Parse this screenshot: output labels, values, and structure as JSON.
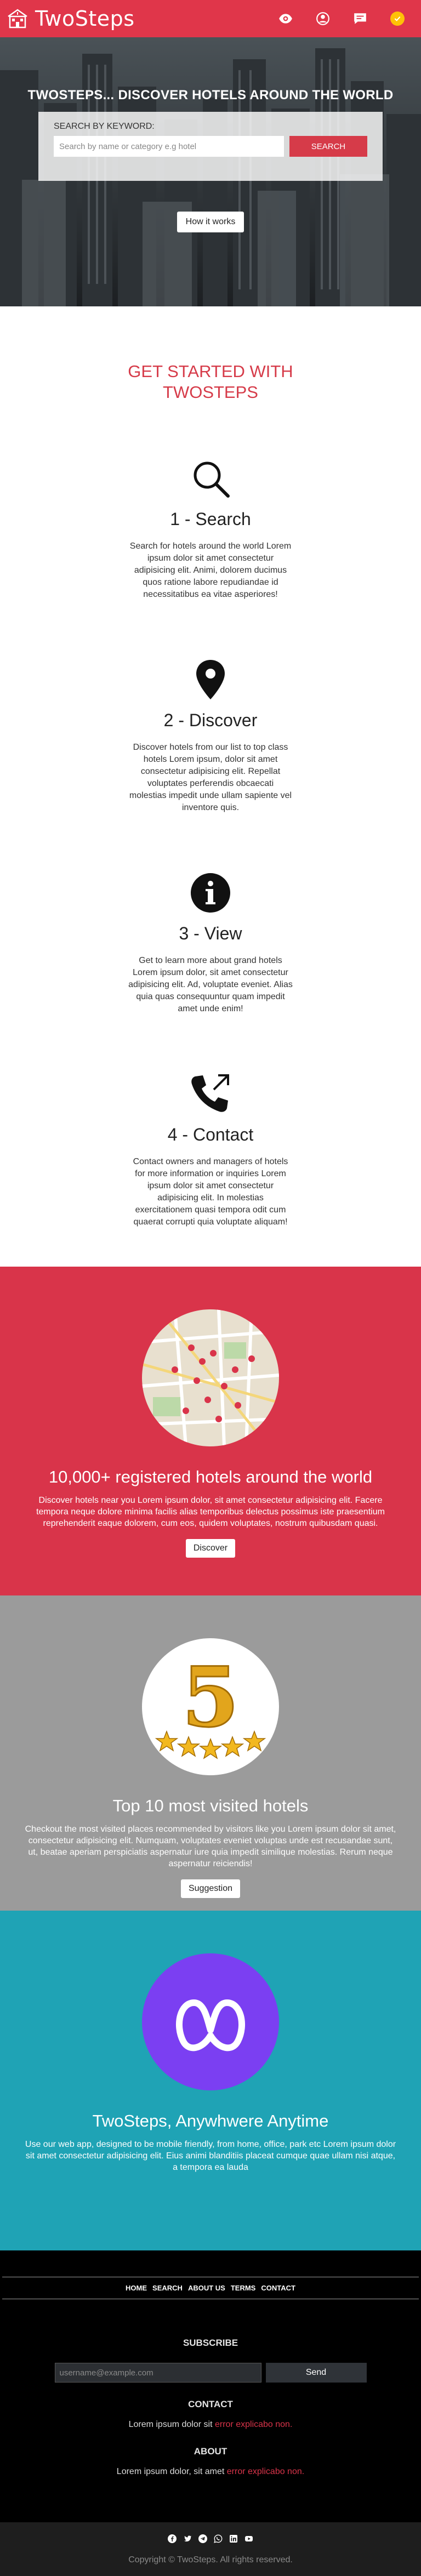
{
  "brand": {
    "name": "TwoSteps"
  },
  "nav": {
    "icons": [
      "eye-icon",
      "user-icon",
      "chat-icon",
      "badge-check-icon"
    ],
    "accent": "#e0364a",
    "badge_color": "#ffc107"
  },
  "hero": {
    "title": "TWOSTEPS... DISCOVER HOTELS AROUND THE WORLD",
    "search_label": "SEARCH BY KEYWORD:",
    "search_placeholder": "Search by name or category e.g hotel",
    "search_button": "SEARCH",
    "how_button": "How it works"
  },
  "steps": {
    "title": "GET STARTED WITH TWOSTEPS",
    "items": [
      {
        "icon": "search-icon",
        "title": "1 - Search",
        "text": "Search for hotels around the world Lorem ipsum dolor sit amet consectetur adipisicing elit. Animi, dolorem ducimus quos ratione labore repudiandae id necessitatibus ea vitae asperiores!"
      },
      {
        "icon": "map-pin-icon",
        "title": "2 - Discover",
        "text": "Discover hotels from our list to top class hotels Lorem ipsum, dolor sit amet consectetur adipisicing elit. Repellat voluptates perferendis obcaecati molestias impedit unde ullam sapiente vel inventore quis."
      },
      {
        "icon": "info-icon",
        "title": "3 - View",
        "text": "Get to learn more about grand hotels Lorem ipsum dolor, sit amet consectetur adipisicing elit. Ad, voluptate eveniet. Alias quia quas consequuntur quam impedit amet unde enim!"
      },
      {
        "icon": "phone-outgoing-icon",
        "title": "4 - Contact",
        "text": "Contact owners and managers of hotels for more information or inquiries Lorem ipsum dolor sit amet consectetur adipisicing elit. In molestias exercitationem quasi tempora odit cum quaerat corrupti quia voluptate aliquam!"
      }
    ]
  },
  "features": {
    "registered": {
      "title": "10,000+ registered hotels around the world",
      "text": "Discover hotels near you Lorem ipsum dolor, sit amet consectetur adipisicing elit. Facere tempora neque dolore minima facilis alias temporibus delectus possimus iste praesentium reprehenderit eaque dolorem, cum eos, quidem voluptates, nostrum quibusdam quasi.",
      "button": "Discover",
      "color": "#d9344a"
    },
    "visited": {
      "title": "Top 10 most visited hotels",
      "text": "Checkout the most visited places recommended by visitors like you Lorem ipsum dolor sit amet, consectetur adipisicing elit. Numquam, voluptates eveniet voluptas unde est recusandae sunt, ut, beatae aperiam perspiciatis aspernatur iure quia impedit similique molestias. Rerum neque aspernatur reiciendis!",
      "button": "Suggestion",
      "badge_number": "5",
      "color": "#9b9b9b"
    },
    "anytime": {
      "title": "TwoSteps, Anywhwere Anytime",
      "text": "Use our web app, designed to be mobile friendly, from home, office, park etc Lorem ipsum dolor sit amet consectetur adipisicing elit. Eius animi blanditiis placeat cumque quae ullam nisi atque, a tempora ea lauda",
      "color": "#1fa3b5",
      "logo_color": "#7b3ff2"
    }
  },
  "footer": {
    "nav": [
      "HOME",
      "SEARCH",
      "ABOUT US",
      "TERMS",
      "CONTACT"
    ],
    "subscribe_heading": "SUBSCRIBE",
    "subscribe_placeholder": "username@example.com",
    "subscribe_button": "Send",
    "contact_heading": "CONTACT",
    "contact_text": "Lorem ipsum dolor sit",
    "contact_error": "error explicabo non.",
    "about_heading": "ABOUT",
    "about_text": "Lorem ipsum dolor, sit amet",
    "about_error": "error explicabo non.",
    "social": [
      "facebook-icon",
      "twitter-icon",
      "telegram-icon",
      "whatsapp-icon",
      "linkedin-icon",
      "youtube-icon"
    ],
    "copyright": "Copyright © TwoSteps. All rights reserved."
  }
}
